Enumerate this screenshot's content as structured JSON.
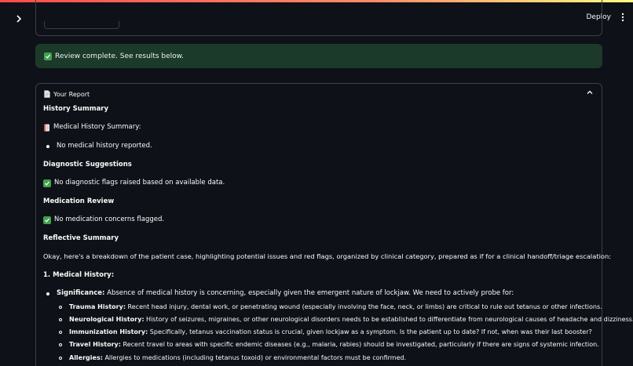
{
  "header": {
    "deploy_label": "Deploy"
  },
  "alert": {
    "text": "Review complete. See results below."
  },
  "report": {
    "title": "Your Report",
    "history_heading": "History Summary",
    "history_sub": "Medical History Summary:",
    "history_item": "No medical history reported.",
    "diag_heading": "Diagnostic Suggestions",
    "diag_text": "No diagnostic flags raised based on available data.",
    "med_heading": "Medication Review",
    "med_text": "No medication concerns flagged.",
    "reflective_heading": "Reflective Summary",
    "reflective_intro": "Okay, here's a breakdown of the patient case, highlighting potential issues and red flags, organized by clinical category, prepared as if for a clinical handoff/triage escalation:",
    "section1": "1. Medical History:",
    "significance_label": "Significance:",
    "significance_text": " Absence of medical history is concerning, especially given the emergent nature of lockjaw. We need to actively probe for:",
    "sub_items": [
      {
        "label": "Trauma History:",
        "text": " Recent head injury, dental work, or penetrating wound (especially involving the face, neck, or limbs) are critical to rule out tetanus or other infections."
      },
      {
        "label": "Neurological History:",
        "text": " History of seizures, migraines, or other neurological disorders needs to be established to differentiate from neurological causes of headache and dizziness."
      },
      {
        "label": "Immunization History:",
        "text": " Specifically, tetanus vaccination status is crucial, given lockjaw as a symptom. Is the patient up to date? If not, when was their last booster?"
      },
      {
        "label": "Travel History:",
        "text": " Recent travel to areas with specific endemic diseases (e.g., malaria, rabies) should be investigated, particularly if there are signs of systemic infection."
      },
      {
        "label": "Allergies:",
        "text": " Allergies to medications (including tetanus toxoid) or environmental factors must be confirmed."
      }
    ]
  }
}
